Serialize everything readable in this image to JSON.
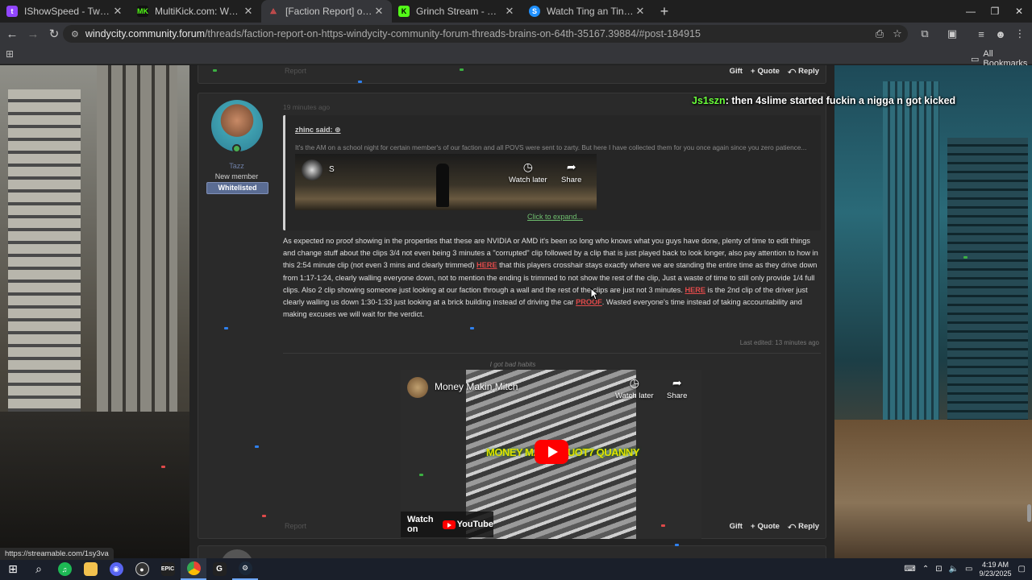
{
  "browser": {
    "tabs": [
      {
        "title": "IShowSpeed - Twitch",
        "favicon": "twitch-icon",
        "color": "#9146ff",
        "active": false
      },
      {
        "title": "MultiKick.com: Watch Multiple Kick Streams",
        "favicon": "multikick-icon",
        "color": "#53fc18",
        "active": false
      },
      {
        "title": "[Faction Report] on https://windycity",
        "favicon": "forum-icon",
        "color": "#c0392b",
        "active": true
      },
      {
        "title": "Grinch Stream - Watch Live on Kick",
        "favicon": "kick-icon",
        "color": "#53fc18",
        "active": false
      },
      {
        "title": "Watch Ting an Tings | Streamable",
        "favicon": "streamable-icon",
        "color": "#1e90ff",
        "active": false
      }
    ],
    "url_host": "windycity.community.forum",
    "url_path": "/threads/faction-report-on-https-windycity-community-forum-threads-brains-on-64th-35167.39884/#post-184915",
    "all_bookmarks": "All Bookmarks",
    "status_url": "https://streamable.com/1sy3va"
  },
  "forum": {
    "prev_post": {
      "report": "Report",
      "actions": {
        "gift": "Gift",
        "quote": "Quote",
        "reply": "Reply"
      }
    },
    "post": {
      "username": "Tazz",
      "user_title": "New member",
      "banner": "Whitelisted",
      "time": "19 minutes ago",
      "quote": {
        "author": "zhinc said:",
        "text": "It's the AM on a school night for certain member's of our faction and all POVS were sent to zarty. But here I have collected them for you once again since you zero patience...",
        "clip_channel": "S",
        "watch_later": "Watch later",
        "share": "Share",
        "expand": "Click to expand..."
      },
      "body": {
        "p1": "As expected no proof showing in the properties that these are NVIDIA or AMD it's been so long who knows what you guys have done, plenty of time to edit things and change stuff about the clips 3/4 not even being 3 minutes a \"corrupted\" clip followed by a clip that is just played back to look longer, also pay attention to how in this 2:54 minute clip (not even 3 mins and clearly trimmed) ",
        "link1": "HERE",
        "p2": " that this players crosshair stays exactly where we are standing the entire time as they drive down from 1:17-1:24, clearly walling everyone down, not to mention the ending is trimmed to not show the rest of the clip, Just a waste of time to still only provide 1/4 full clips. Also 2 clip showing someone just looking at our faction through a wall and the rest of the clips are just not 3 minutes. ",
        "link2": "HERE",
        "p3": " is the 2nd clip of the driver just clearly walling us down 1:30-1:33 just looking at a brick building instead of driving the car ",
        "link3": "PROOF",
        "p4": ". Wasted everyone's time instead of taking accountability and making excuses we will wait for the verdict."
      },
      "last_edited": "Last edited: 13 minutes ago",
      "signature": "I got bad habits",
      "video": {
        "channel": "Money Makin Mitch",
        "watch_later": "Watch later",
        "share": "Share",
        "overlay_text": "MONEY MAKIN QUOT7 QUANNY",
        "watch_on": "Watch on",
        "youtube": "YouTube"
      },
      "report": "Report",
      "actions": {
        "gift": "Gift",
        "quote": "Quote",
        "reply": "Reply"
      }
    }
  },
  "stream_overlay": {
    "chat_name": "Js1szn",
    "chat_message": ": then 4slime started fuckin a nigga n got kicked"
  },
  "taskbar": {
    "time": "4:19 AM",
    "date": "9/23/2025",
    "apps": [
      "start-icon",
      "search-icon",
      "spotify-icon",
      "file-explorer-icon",
      "discord-icon",
      "obs-icon",
      "epic-games-icon",
      "chrome-icon",
      "kick-icon",
      "steam-icon"
    ]
  }
}
